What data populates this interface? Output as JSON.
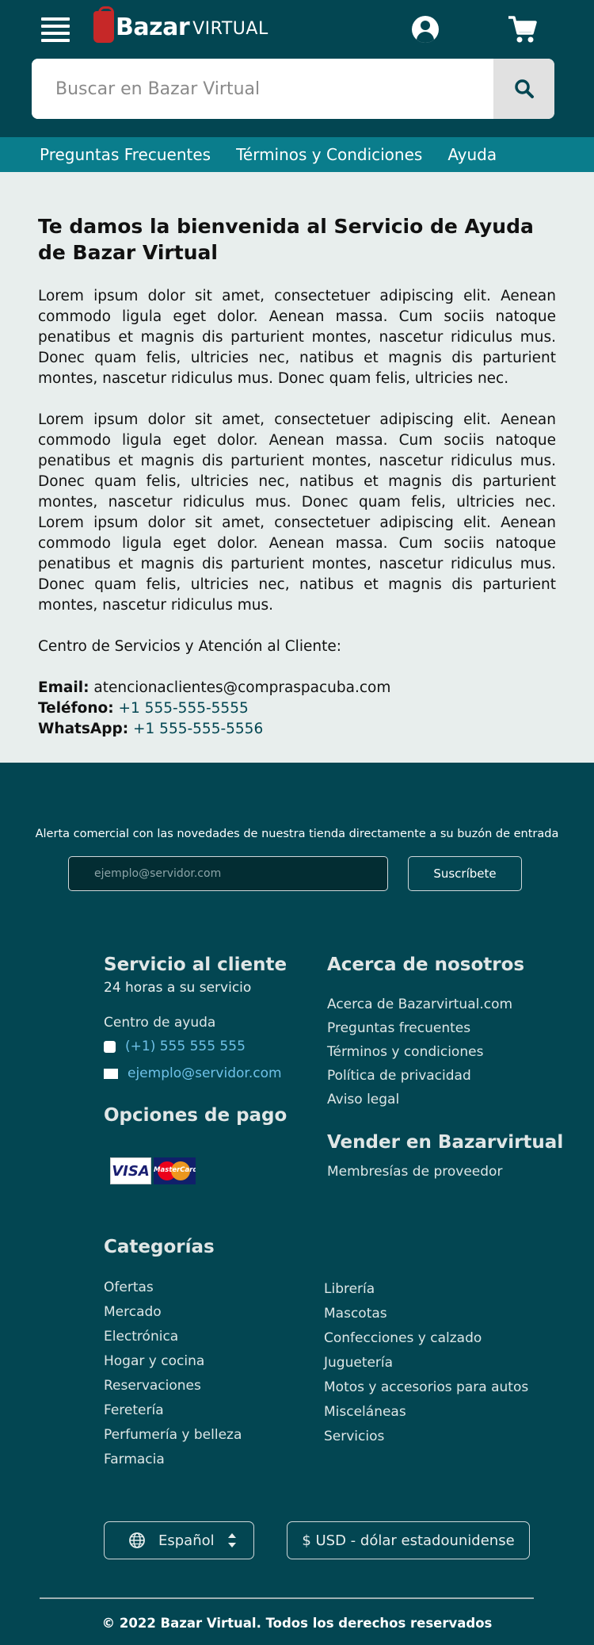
{
  "header": {
    "logo_first": "Bazar",
    "logo_second": "VIRTUAL",
    "search_placeholder": "Buscar en Bazar Virtual"
  },
  "subnav": [
    "Preguntas Frecuentes",
    "Términos y Condiciones",
    "Ayuda"
  ],
  "main": {
    "title": "Te damos la bienvenida al Servicio de Ayuda\n de Bazar Virtual",
    "paragraph1": "Lorem ipsum dolor sit amet, consectetuer adipiscing elit. Aenean commodo ligula eget dolor. Aenean massa. Cum sociis natoque penatibus et magnis dis parturient montes, nascetur ridiculus mus. Donec quam felis, ultricies nec, natibus et magnis dis parturient montes, nascetur ridiculus mus. Donec quam felis, ultricies nec.",
    "paragraph2": "Lorem ipsum dolor sit amet, consectetuer adipiscing elit. Aenean commodo ligula eget dolor. Aenean massa. Cum sociis natoque penatibus et magnis dis parturient montes, nascetur ridiculus mus. Donec quam felis, ultricies nec, natibus et magnis dis parturient montes, nascetur ridiculus mus. Donec quam felis, ultricies nec. Lorem ipsum dolor sit amet, consectetuer adipiscing elit. Aenean commodo ligula eget dolor. Aenean massa. Cum sociis natoque penatibus et magnis dis parturient montes, nascetur ridiculus mus. Donec quam felis, ultricies nec, natibus et magnis dis parturient montes, nascetur ridiculus mus.",
    "center_label": "Centro de Servicios y Atención al Cliente:",
    "email_label": "Email:",
    "email_value": "atencionaclientes@compraspacuba.com",
    "phone_label": "Teléfono:",
    "phone_value": "+1 555-555-5555",
    "whatsapp_label": "WhatsApp:",
    "whatsapp_value": "+1 555-555-5556"
  },
  "footer": {
    "newsletter_title": "Alerta comercial con las novedades de nuestra tienda directamente a su buzón de entrada",
    "newsletter_placeholder": "ejemplo@servidor.com",
    "subscribe_label": "Suscríbete",
    "service_title": "Servicio al cliente",
    "service_hours": "24 horas a su servicio",
    "help_center": "Centro de ayuda",
    "phone": "(+1) 555 555 555",
    "email": "ejemplo@servidor.com",
    "payment_title": "Opciones de pago",
    "visa_label": "VISA",
    "mastercard_label": "MasterCard",
    "about_title": "Acerca de nosotros",
    "about_links": [
      "Acerca de Bazarvirtual.com",
      "Preguntas frecuentes",
      "Términos y condiciones",
      "Política de privacidad",
      "Aviso legal"
    ],
    "sell_title": "Vender en Bazarvirtual",
    "sell_link": "Membresías de proveedor",
    "categories_title": "Categorías",
    "categories_left": [
      "Ofertas",
      "Mercado",
      "Electrónica",
      "Hogar y cocina",
      "Reservaciones",
      "Feretería",
      "Perfumería y belleza",
      "Farmacia"
    ],
    "categories_right": [
      "Librería",
      "Mascotas",
      "Confecciones y calzado",
      "Juguetería",
      "Motos y accesorios para autos",
      "Misceláneas",
      "Servicios"
    ],
    "language": "Español",
    "currency": "$ USD - dólar estadounidense",
    "copyright": "© 2022  Bazar Virtual. Todos los derechos reservados"
  }
}
